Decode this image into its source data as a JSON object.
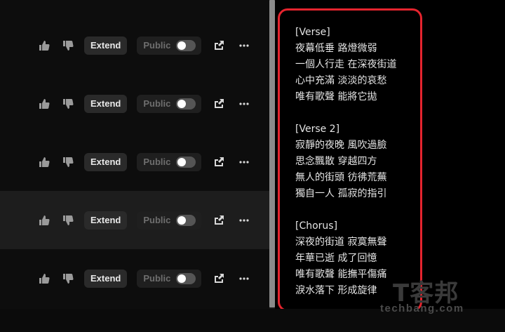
{
  "song_rows": [
    {
      "extend_label": "Extend",
      "public_label": "Public",
      "public_on": false
    },
    {
      "extend_label": "Extend",
      "public_label": "Public",
      "public_on": false
    },
    {
      "extend_label": "Extend",
      "public_label": "Public",
      "public_on": false
    },
    {
      "extend_label": "Extend",
      "public_label": "Public",
      "public_on": false
    },
    {
      "extend_label": "Extend",
      "public_label": "Public",
      "public_on": false
    }
  ],
  "icons": {
    "like": "thumbs-up-icon",
    "dislike": "thumbs-down-icon",
    "share": "share-icon",
    "more": "more-dots-icon"
  },
  "lyrics": {
    "stanzas": [
      {
        "header": "[Verse]",
        "lines": [
          "夜幕低垂 路燈微弱",
          "一個人行走 在深夜街道",
          "心中充滿 淡淡的哀愁",
          "唯有歌聲 能將它拋"
        ]
      },
      {
        "header": "[Verse 2]",
        "lines": [
          "寂靜的夜晚 風吹過臉",
          "思念飄散 穿越四方",
          "無人的街頭 彷彿荒蕪",
          "獨自一人 孤寂的指引"
        ]
      },
      {
        "header": "[Chorus]",
        "lines": [
          "深夜的街道 寂寞無聲",
          "年華已逝 成了回憶",
          "唯有歌聲 能撫平傷痛",
          "淚水落下 形成旋律"
        ]
      }
    ]
  },
  "watermark": {
    "cjk": "T客邦",
    "latin": "techbang.com"
  },
  "colors": {
    "highlight_border": "#e5242e",
    "row_highlight": "#1d1d1d"
  }
}
